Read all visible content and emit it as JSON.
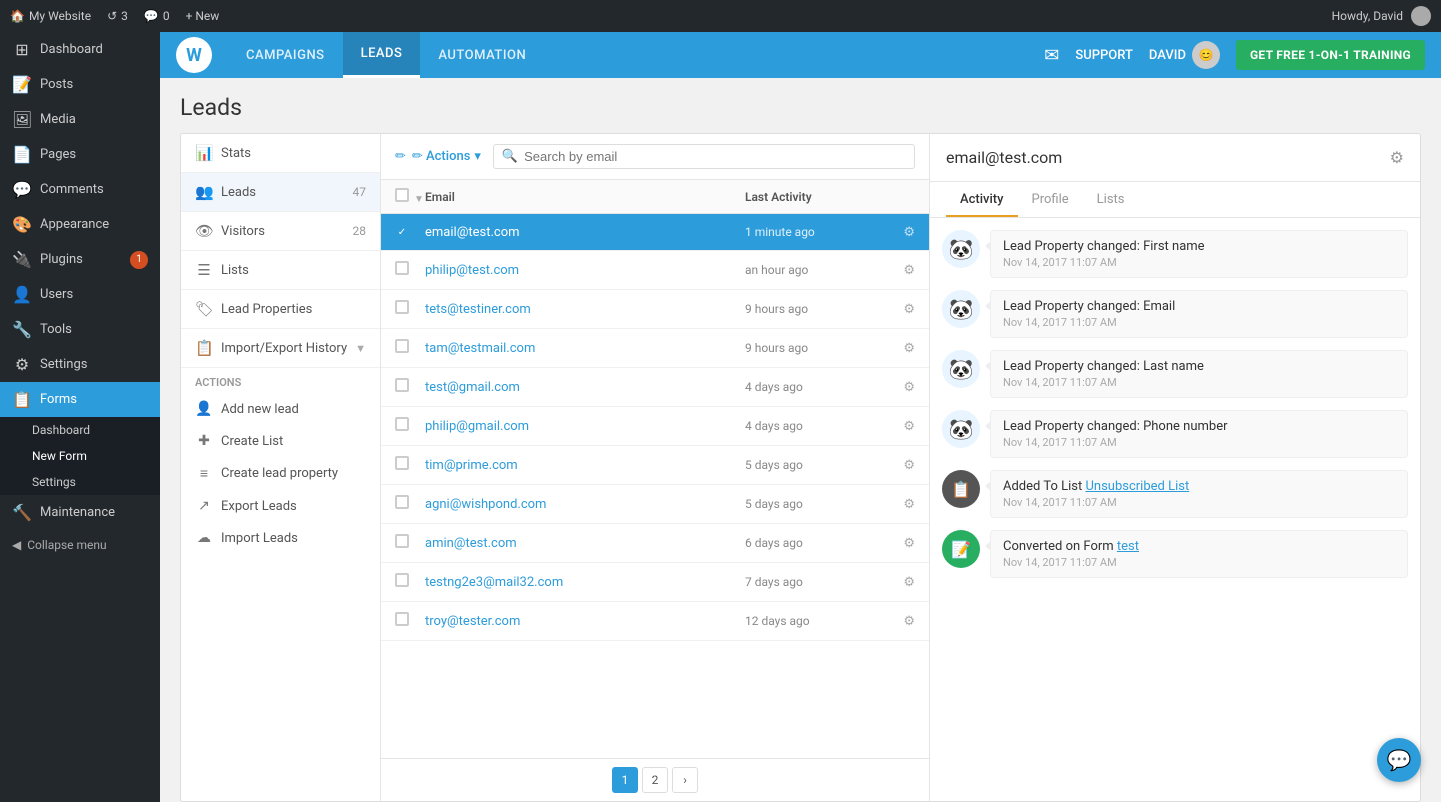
{
  "adminBar": {
    "siteName": "My Website",
    "revisionsCount": "3",
    "commentsCount": "0",
    "newLabel": "+ New",
    "howdy": "Howdy, David"
  },
  "wpSidebar": {
    "items": [
      {
        "id": "dashboard",
        "label": "Dashboard",
        "icon": "⊞"
      },
      {
        "id": "posts",
        "label": "Posts",
        "icon": "📝"
      },
      {
        "id": "media",
        "label": "Media",
        "icon": "🖼"
      },
      {
        "id": "pages",
        "label": "Pages",
        "icon": "📄"
      },
      {
        "id": "comments",
        "label": "Comments",
        "icon": "💬"
      },
      {
        "id": "appearance",
        "label": "Appearance",
        "icon": "🎨"
      },
      {
        "id": "plugins",
        "label": "Plugins",
        "icon": "🔌",
        "badge": "1"
      },
      {
        "id": "users",
        "label": "Users",
        "icon": "👤"
      },
      {
        "id": "tools",
        "label": "Tools",
        "icon": "🔧"
      },
      {
        "id": "settings",
        "label": "Settings",
        "icon": "⚙"
      }
    ],
    "forms": {
      "label": "Forms",
      "subItems": [
        {
          "id": "dashboard",
          "label": "Dashboard"
        },
        {
          "id": "new-form",
          "label": "New Form"
        },
        {
          "id": "settings",
          "label": "Settings"
        }
      ]
    },
    "maintenance": {
      "label": "Maintenance"
    },
    "collapseMenu": "Collapse menu"
  },
  "topNav": {
    "campaigns": "CAMPAIGNS",
    "leads": "LEADS",
    "automation": "AUTOMATION",
    "support": "SUPPORT",
    "userName": "DAVID",
    "cta": "GET FREE 1-ON-1 TRAINING"
  },
  "page": {
    "title": "Leads"
  },
  "leftSidebar": {
    "items": [
      {
        "id": "stats",
        "label": "Stats",
        "icon": "📊"
      },
      {
        "id": "leads",
        "label": "Leads",
        "icon": "👥",
        "count": "47"
      },
      {
        "id": "visitors",
        "label": "Visitors",
        "icon": "👁",
        "count": "28"
      },
      {
        "id": "lists",
        "label": "Lists",
        "icon": "☰"
      },
      {
        "id": "lead-properties",
        "label": "Lead Properties",
        "icon": "🏷"
      },
      {
        "id": "import-export",
        "label": "Import/Export History",
        "icon": "📋",
        "hasArrow": true
      }
    ],
    "actionsLabel": "Actions",
    "actions": [
      {
        "id": "add-new-lead",
        "label": "Add new lead",
        "icon": "👤+"
      },
      {
        "id": "create-list",
        "label": "Create List",
        "icon": "+"
      },
      {
        "id": "create-lead-property",
        "label": "Create lead property",
        "icon": "≡"
      },
      {
        "id": "export-leads",
        "label": "Export Leads",
        "icon": "↗"
      },
      {
        "id": "import-leads",
        "label": "Import Leads",
        "icon": "☁"
      }
    ]
  },
  "leadsTable": {
    "actionsBtn": "✏ Actions",
    "searchPlaceholder": "Search by email",
    "columns": {
      "email": "Email",
      "lastActivity": "Last Activity"
    },
    "rows": [
      {
        "email": "email@test.com",
        "activity": "1 minute ago",
        "selected": true
      },
      {
        "email": "philip@test.com",
        "activity": "an hour ago"
      },
      {
        "email": "tets@testiner.com",
        "activity": "9 hours ago"
      },
      {
        "email": "tam@testmail.com",
        "activity": "9 hours ago"
      },
      {
        "email": "test@gmail.com",
        "activity": "4 days ago"
      },
      {
        "email": "philip@gmail.com",
        "activity": "4 days ago"
      },
      {
        "email": "tim@prime.com",
        "activity": "5 days ago"
      },
      {
        "email": "agni@wishpond.com",
        "activity": "5 days ago"
      },
      {
        "email": "amin@test.com",
        "activity": "6 days ago"
      },
      {
        "email": "testng2e3@mail32.com",
        "activity": "7 days ago"
      },
      {
        "email": "troy@tester.com",
        "activity": "12 days ago"
      }
    ],
    "pagination": [
      "1",
      "2",
      "›"
    ]
  },
  "rightPanel": {
    "emailTitle": "email@test.com",
    "tabs": [
      "Activity",
      "Profile",
      "Lists"
    ],
    "activeTab": "Activity",
    "activities": [
      {
        "id": 1,
        "avatarType": "panda",
        "text": "Lead Property changed: First name",
        "time": "Nov 14, 2017 11:07 AM"
      },
      {
        "id": 2,
        "avatarType": "panda",
        "text": "Lead Property changed: Email",
        "time": "Nov 14, 2017 11:07 AM"
      },
      {
        "id": 3,
        "avatarType": "panda",
        "text": "Lead Property changed: Last name",
        "time": "Nov 14, 2017 11:07 AM"
      },
      {
        "id": 4,
        "avatarType": "panda",
        "text": "Lead Property changed: Phone number",
        "time": "Nov 14, 2017 11:07 AM"
      },
      {
        "id": 5,
        "avatarType": "list",
        "textBefore": "Added To List ",
        "linkText": "Unsubscribed List",
        "textAfter": "",
        "time": "Nov 14, 2017 11:07 AM",
        "hasLink": true
      },
      {
        "id": 6,
        "avatarType": "form",
        "textBefore": "Converted on Form ",
        "linkText": "test",
        "textAfter": "",
        "time": "Nov 14, 2017 11:07 AM",
        "hasLink": true
      }
    ]
  }
}
